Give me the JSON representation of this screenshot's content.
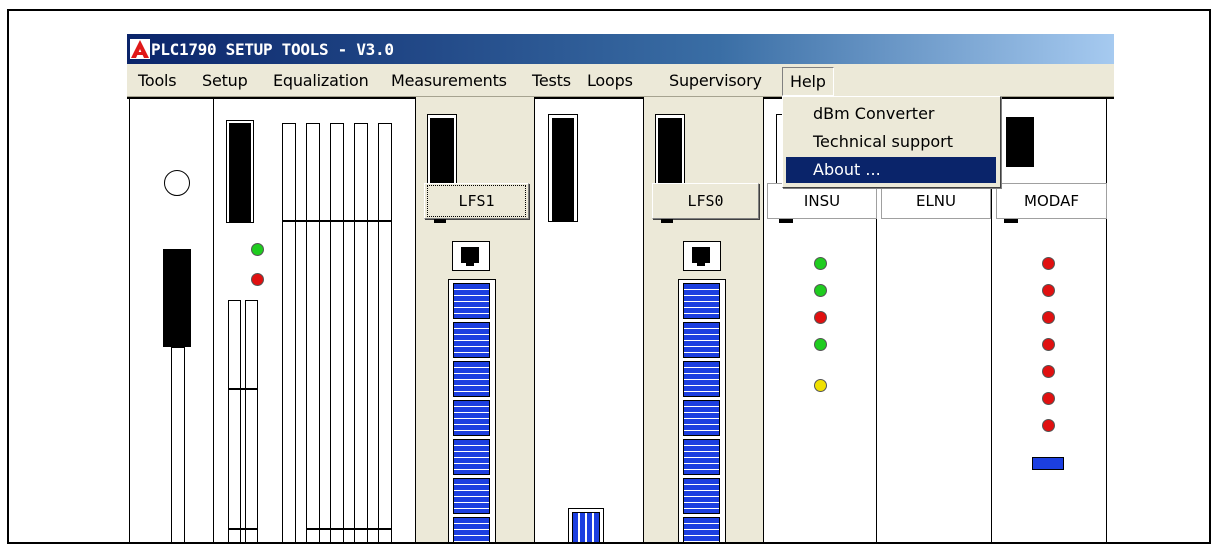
{
  "window": {
    "title": "PLC1790 SETUP TOOLS  -  V3.0",
    "logo_icon": "app-logo-icon"
  },
  "menubar": {
    "items": [
      "Tools",
      "Setup",
      "Equalization",
      "Measurements",
      "Tests",
      "Loops",
      "Supervisory",
      "Help"
    ],
    "active": "Help"
  },
  "help_menu": {
    "items": [
      "dBm Converter",
      "Technical support",
      "About ..."
    ],
    "selected": "About ..."
  },
  "cards": {
    "lfs1": "LFS1",
    "lfs0": "LFS0",
    "insu": "INSU",
    "elnu": "ELNU",
    "modaf": "MODAF"
  },
  "colors": {
    "title_bar_start": "#0a246a",
    "menu_bg": "#ece9d8",
    "selection": "#0a246a",
    "led_green": "#1fcc1f",
    "led_red": "#e01010",
    "led_yellow": "#f0e000",
    "module_blue": "#1c3fe0"
  },
  "leds": {
    "slot2": [
      "green",
      "red"
    ],
    "insu": [
      "green",
      "green",
      "red",
      "green",
      "yellow"
    ],
    "modaf": [
      "red",
      "red",
      "red",
      "red",
      "red",
      "red",
      "red"
    ]
  }
}
